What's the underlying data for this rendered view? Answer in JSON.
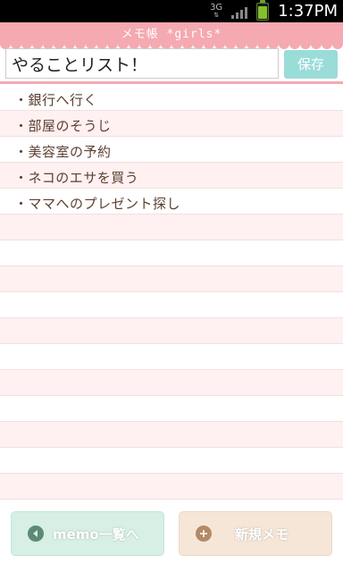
{
  "status_bar": {
    "network": "3G",
    "time": "1:37PM"
  },
  "header": {
    "title": "メモ帳 *girls*"
  },
  "memo": {
    "title_value": "やることリスト！",
    "save_label": "保存"
  },
  "list": {
    "items": [
      "・銀行へ行く",
      "・部屋のそうじ",
      "・美容室の予約",
      "・ネコのエサを買う",
      "・ママへのプレゼント探し"
    ]
  },
  "bottom": {
    "memo_list_label": "memo一覧へ",
    "new_memo_label": "新規メモ"
  },
  "colors": {
    "header_pink": "#f5a9b1",
    "save_button": "#9adcd8",
    "row_alt": "#fff0f1",
    "memo_button": "#d7efe4",
    "new_button": "#f5e6d7"
  }
}
